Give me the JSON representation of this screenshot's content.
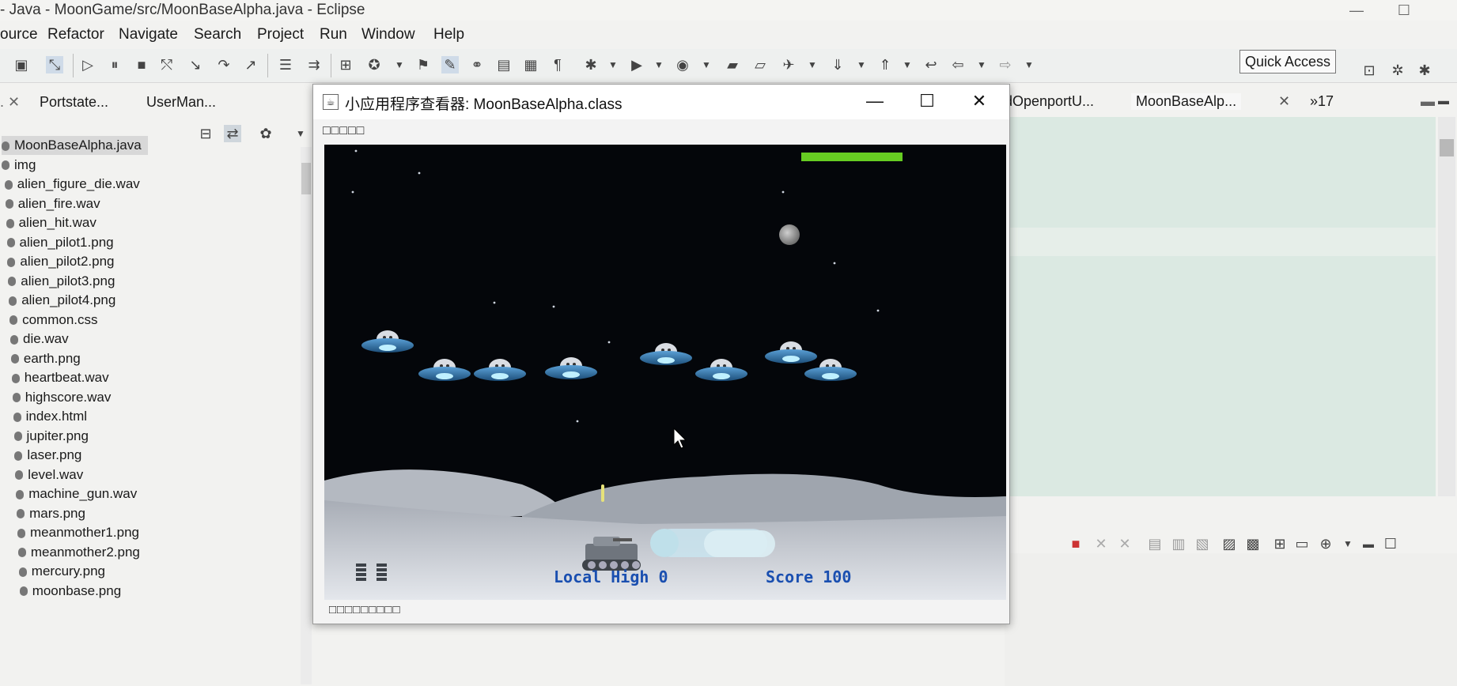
{
  "eclipse": {
    "window_title": "- Java - MoonGame/src/MoonBaseAlpha.java - Eclipse",
    "menu": [
      "ource",
      "Refactor",
      "Navigate",
      "Search",
      "Project",
      "Run",
      "Window",
      "Help"
    ],
    "quick_access": "Quick Access",
    "left_tabs": [
      "Portstate...",
      "UserMan..."
    ],
    "editor_tabs": [
      "dOpenportU...",
      "MoonBaseAlp...",
      "»17"
    ],
    "files": [
      "MoonBaseAlpha.java",
      "img",
      "alien_figure_die.wav",
      "alien_fire.wav",
      "alien_hit.wav",
      "alien_pilot1.png",
      "alien_pilot2.png",
      "alien_pilot3.png",
      "alien_pilot4.png",
      "common.css",
      "die.wav",
      "earth.png",
      "heartbeat.wav",
      "highscore.wav",
      "index.html",
      "jupiter.png",
      "laser.png",
      "level.wav",
      "machine_gun.wav",
      "mars.png",
      "meanmother1.png",
      "meanmother2.png",
      "mercury.png",
      "moonbase.png"
    ],
    "selected_file": "MoonBaseAlpha.java"
  },
  "applet": {
    "window_title": "小应用程序查看器: MoonBaseAlpha.class",
    "menu_label": "□□□□□",
    "status_text": "□□□□□□□□□",
    "controls": {
      "minimize": "—",
      "maximize": "☐",
      "close": "✕"
    },
    "hud": {
      "local_high": "Local High 0",
      "score": "Score 100",
      "energy_fraction": 1.0
    },
    "lives": 2
  },
  "colors": {
    "space": "#04060a",
    "moon_ground": "#cfd4db",
    "hud_text": "#1a4fb0",
    "energy_bar": "#66cc22",
    "ufo_body": "#3a7fb5"
  }
}
